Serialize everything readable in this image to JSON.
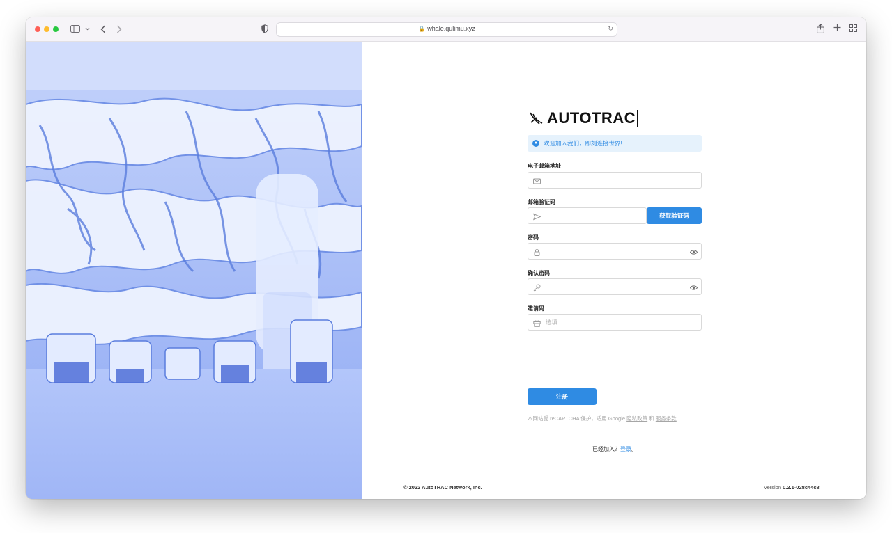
{
  "browser": {
    "url": "whale.qulimu.xyz"
  },
  "brand": {
    "name": "AUTOTRAC",
    "accent": "#2f8be3"
  },
  "alert": {
    "icon": "info-circle-icon",
    "text": "欢迎加入我们，即刻连接世界!"
  },
  "form": {
    "email_label": "电子邮箱地址",
    "email_value": "",
    "code_label": "邮箱验证码",
    "code_value": "",
    "code_button": "获取验证码",
    "password_label": "密码",
    "password_value": "",
    "confirm_label": "确认密码",
    "confirm_value": "",
    "invite_label": "邀请码",
    "invite_placeholder": "选填",
    "submit": "注册"
  },
  "recaptcha": {
    "prefix": "本网站受 reCAPTCHA 保护，适用 Google",
    "privacy": "隐私政策",
    "and": "和",
    "terms": "服务条款"
  },
  "login": {
    "prefix": "已经加入？",
    "link": "登录",
    "suffix": "。"
  },
  "footer": {
    "copyright": "© 2022 AutoTRAC Network, Inc.",
    "version_label": "Version",
    "version_value": "0.2.1-028c44c8"
  }
}
